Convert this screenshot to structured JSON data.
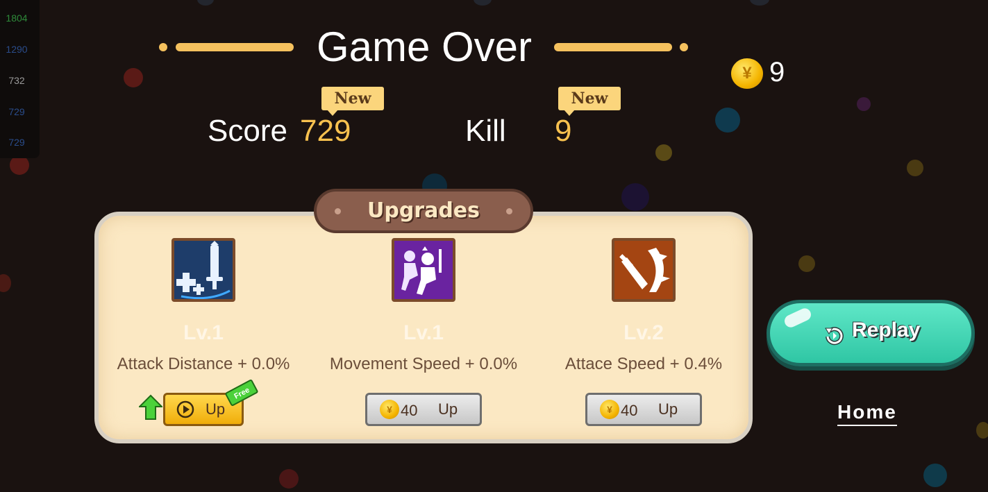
{
  "leaderboard": [
    {
      "value": "1804",
      "color": "#2e8b3a"
    },
    {
      "value": "1290",
      "color": "#2a4c8a"
    },
    {
      "value": "732",
      "color": "#9a9a9a"
    },
    {
      "value": "729",
      "color": "#2a4c8a"
    },
    {
      "value": "729",
      "color": "#2a4c8a"
    }
  ],
  "title": "Game Over",
  "coins": {
    "icon": "coin-icon",
    "symbol": "¥",
    "count": "9"
  },
  "stats": {
    "score_label": "Score",
    "score_value": "729",
    "score_badge": "New",
    "kill_label": "Kill",
    "kill_value": "9",
    "kill_badge": "New"
  },
  "upgrades": {
    "title": "Upgrades",
    "items": [
      {
        "icon": "attack-distance-icon",
        "level": "Lv.1",
        "description": "Attack Distance + 0.0%",
        "button": {
          "type": "free-ad",
          "label": "Up",
          "tag": "Free",
          "icon": "play-icon"
        }
      },
      {
        "icon": "movement-speed-icon",
        "level": "Lv.1",
        "description": "Movement Speed + 0.0%",
        "button": {
          "type": "coin",
          "price": "40",
          "label": "Up"
        }
      },
      {
        "icon": "attack-speed-icon",
        "level": "Lv.2",
        "description": "Attace Speed + 0.4%",
        "button": {
          "type": "coin",
          "price": "40",
          "label": "Up"
        }
      }
    ]
  },
  "actions": {
    "replay_label": "Replay",
    "replay_icon": "replay-icon",
    "home_label": "Home"
  },
  "colors": {
    "accent_gold": "#f7c14f",
    "panel_bg": "#fbe8c3",
    "replay_green": "#3fd6b4",
    "background": "#1a1210"
  }
}
